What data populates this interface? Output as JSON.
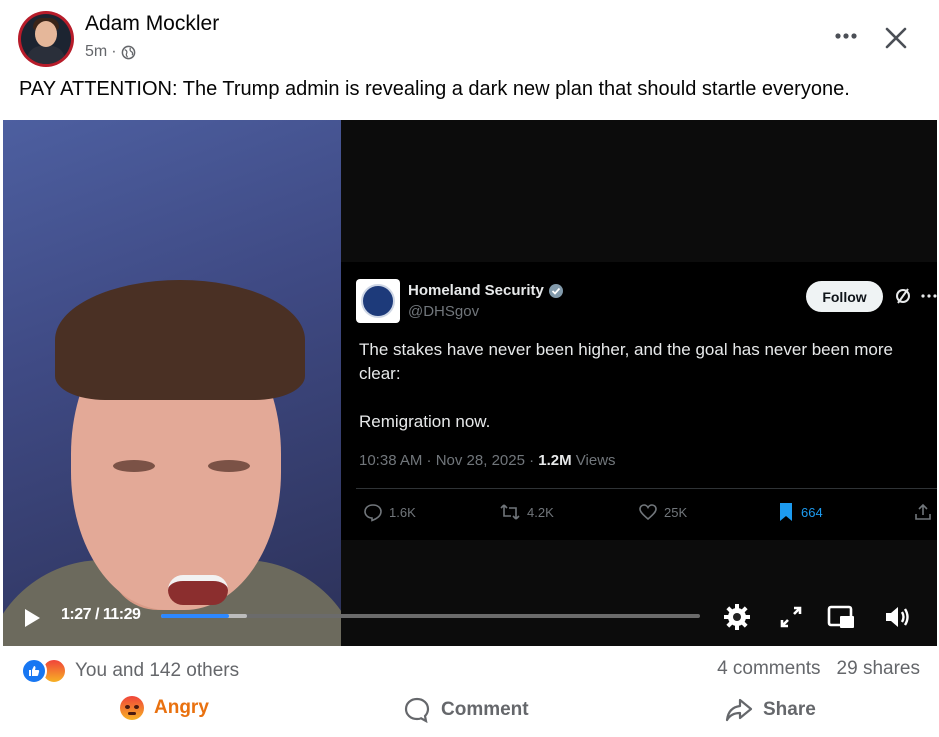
{
  "post": {
    "author": "Adam Mockler",
    "time": "5m",
    "dot": "·",
    "caption": "PAY ATTENTION: The Trump admin is revealing a dark new plan that should startle everyone."
  },
  "icons": {
    "more": "more-dots-icon",
    "close": "close-icon",
    "audience": "globe-icon"
  },
  "tweet": {
    "name": "Homeland Security",
    "handle": "@DHSgov",
    "follow_label": "Follow",
    "text": "The stakes have never been higher, and the goal has never been more clear:\n\nRemigration now.",
    "timestamp": "10:38 AM · Nov 28, 2025 · ",
    "views_count": "1.2M",
    "views_label": " Views",
    "replies": "1.6K",
    "reposts": "4.2K",
    "likes": "25K",
    "bookmarks": "664",
    "colors": {
      "bookmark": "#1d9bf0",
      "verified": "#829aab"
    }
  },
  "video": {
    "current_time": "1:27",
    "separator": " / ",
    "duration": "11:29",
    "progress_fraction": 0.1262,
    "buffered_fraction": 0.16,
    "accent": "#2d88ff"
  },
  "footer": {
    "reaction_summary": "You and 142 others",
    "comments": "4 comments",
    "shares": "29 shares",
    "reaction_label": "Angry",
    "comment_label": "Comment",
    "share_label": "Share",
    "colors": {
      "angry": "#e9710f",
      "like": "#1877f2"
    }
  }
}
